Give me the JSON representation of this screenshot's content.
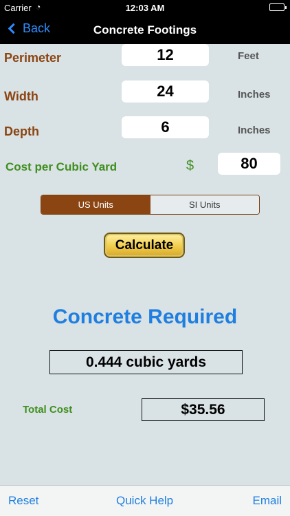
{
  "status": {
    "carrier": "Carrier",
    "time": "12:03 AM"
  },
  "nav": {
    "back_label": "Back",
    "title": "Concrete Footings"
  },
  "inputs": {
    "perimeter": {
      "label": "Perimeter",
      "value": "12",
      "unit": "Feet"
    },
    "width": {
      "label": "Width",
      "value": "24",
      "unit": "Inches"
    },
    "depth": {
      "label": "Depth",
      "value": "6",
      "unit": "Inches"
    },
    "cost": {
      "label": "Cost per Cubic Yard",
      "currency": "$",
      "value": "80"
    }
  },
  "units": {
    "options": [
      "US Units",
      "SI Units"
    ],
    "selected": "US Units"
  },
  "calculate_label": "Calculate",
  "result": {
    "title": "Concrete Required",
    "value": "0.444 cubic yards"
  },
  "total": {
    "label": "Total Cost",
    "value": "$35.56"
  },
  "toolbar": {
    "reset": "Reset",
    "help": "Quick Help",
    "email": "Email"
  },
  "colors": {
    "label_brown": "#8b4513",
    "label_green": "#3f8f1f",
    "accent_blue": "#1f7fe0",
    "button_gold": "#f1cc4a"
  },
  "icons": [
    "wifi-icon",
    "battery-icon",
    "back-chevron-icon"
  ]
}
